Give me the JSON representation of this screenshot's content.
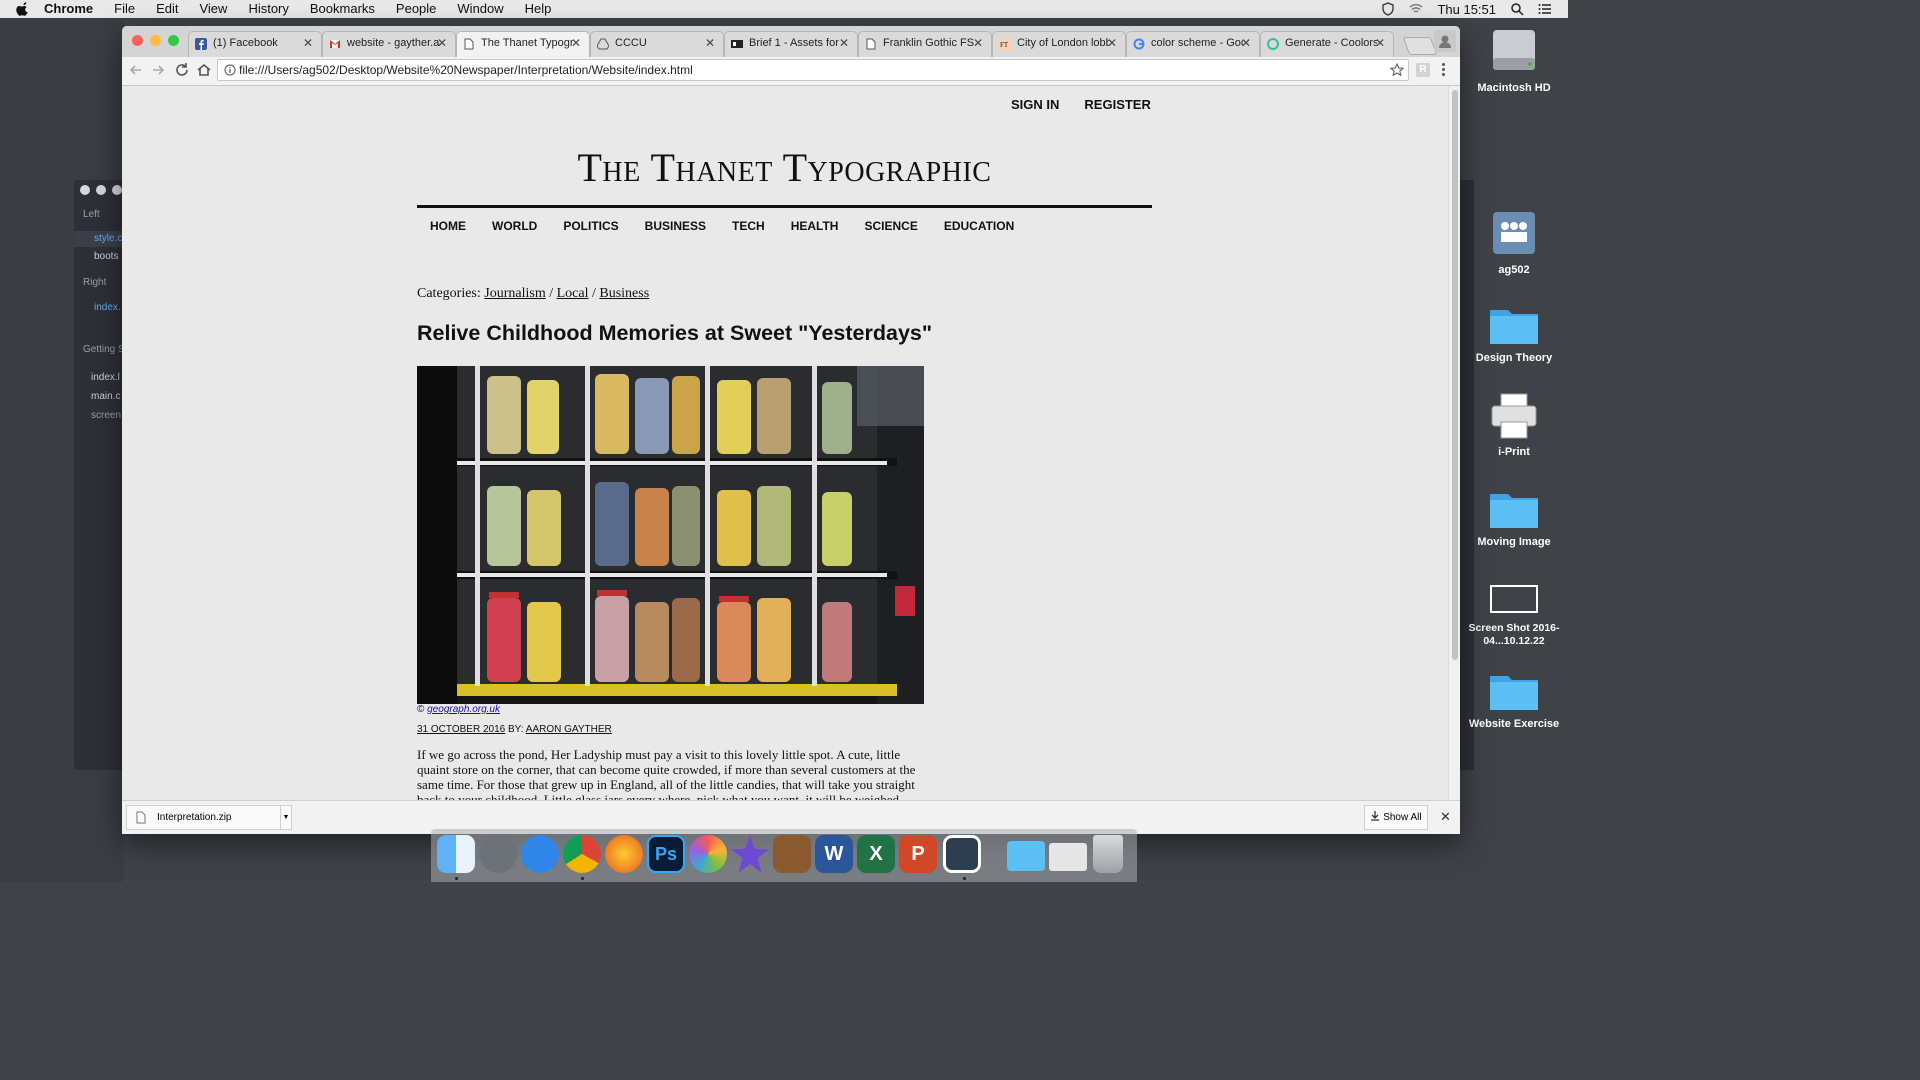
{
  "menubar": {
    "app": "Chrome",
    "items": [
      "File",
      "Edit",
      "View",
      "History",
      "Bookmarks",
      "People",
      "Window",
      "Help"
    ],
    "clock": "Thu 15:51"
  },
  "editor": {
    "left_label": "Left",
    "files_left": [
      "style.c",
      "boots"
    ],
    "right_label": "Right",
    "files_right": [
      "index."
    ],
    "getting_label": "Getting S",
    "files_getting": [
      "index.l",
      "main.c",
      "screen"
    ]
  },
  "desktop": {
    "icons": [
      "Macintosh HD",
      "ag502",
      "Design Theory",
      "i-Print",
      "Moving Image",
      "Screen Shot 2016-04...10.12.22",
      "Website Exercise"
    ]
  },
  "tabs": [
    {
      "title": "(1) Facebook"
    },
    {
      "title": "website - gayther.a"
    },
    {
      "title": "The Thanet Typogr"
    },
    {
      "title": "CCCU"
    },
    {
      "title": "Brief 1 - Assets for"
    },
    {
      "title": "Franklin Gothic FS"
    },
    {
      "title": "City of London lobb"
    },
    {
      "title": "color scheme - Goo"
    },
    {
      "title": "Generate - Coolors"
    }
  ],
  "address": "file:///Users/ag502/Desktop/Website%20Newspaper/Interpretation/Website/index.html",
  "ext_letter": "R",
  "page": {
    "auth": {
      "sign_in": "SIGN IN",
      "register": "REGISTER"
    },
    "site_title": "The Thanet Typographic",
    "nav": [
      "HOME",
      "WORLD",
      "POLITICS",
      "BUSINESS",
      "TECH",
      "HEALTH",
      "SCIENCE",
      "EDUCATION"
    ],
    "categories": {
      "label": "Categories:",
      "sep": "/",
      "items": [
        "Journalism",
        "Local",
        "Business"
      ]
    },
    "headline": "Relive Childhood Memories at Sweet \"Yesterdays\"",
    "photo_credit": {
      "symbol": "©",
      "link": "geograph.org.uk"
    },
    "byline": {
      "date": "31 OCTOBER 2016",
      "by": "BY:",
      "author": "AARON GAYTHER"
    },
    "body": "If we go across the pond, Her Ladyship must pay a visit to this lovely little spot. A cute, little quaint store on the corner, that can become quite crowded, if more than several customers at the same time. For those that grew up in England, all of the little candies, that will take you straight back to your childhood. Little glass jars every where, pick what you want, it will be weighed."
  },
  "downloads": {
    "file": "Interpretation.zip",
    "show_all": "Show All"
  },
  "colors": {
    "page_bg": "#e9e9e9",
    "text": "#111111",
    "link": "#1a0dab"
  }
}
